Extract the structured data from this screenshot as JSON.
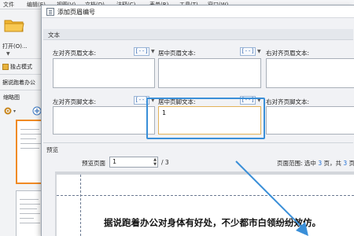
{
  "app": {
    "menu": [
      "文件",
      "编辑(E)",
      "视图(V)",
      "文档(D)",
      "注释(C)",
      "表单(R)",
      "工具(T)",
      "窗口(W)"
    ],
    "open_label": "打开(O)...",
    "solo_mode": "独占模式",
    "status_text": "据说跑着办公",
    "thumbnail_title": "缩略图"
  },
  "dialog": {
    "title": "添加页眉编号",
    "text_section": "文本",
    "header_left_label": "左对齐页眉文本:",
    "header_center_label": "居中页眉文本:",
    "header_right_label": "右对齐页眉文本:",
    "footer_left_label": "左对齐页脚文本:",
    "footer_center_label": "居中页脚文本:",
    "footer_right_label": "右对齐页脚文本:",
    "insert_macro": "[--]",
    "header_left_value": "",
    "header_center_value": "",
    "header_right_value": "",
    "footer_left_value": "",
    "footer_center_value": "1",
    "footer_right_value": "",
    "preview_section": "预览",
    "preview_page_label": "预览页面",
    "preview_page_value": "1",
    "preview_total": "/ 3",
    "page_range_prefix": "页面范围: 选中",
    "page_range_count": "3",
    "page_range_mid": "页，共",
    "page_range_total": "3",
    "page_range_suffix": "页",
    "preview_document_text": "据说跑着办公对身体有好处，不少都市白领纷纷效仿。"
  },
  "colors": {
    "highlight": "#3a8fd8",
    "arrow": "#3a8fd8",
    "active_field_border": "#e2b259",
    "range_number": "#1f6fd6"
  }
}
